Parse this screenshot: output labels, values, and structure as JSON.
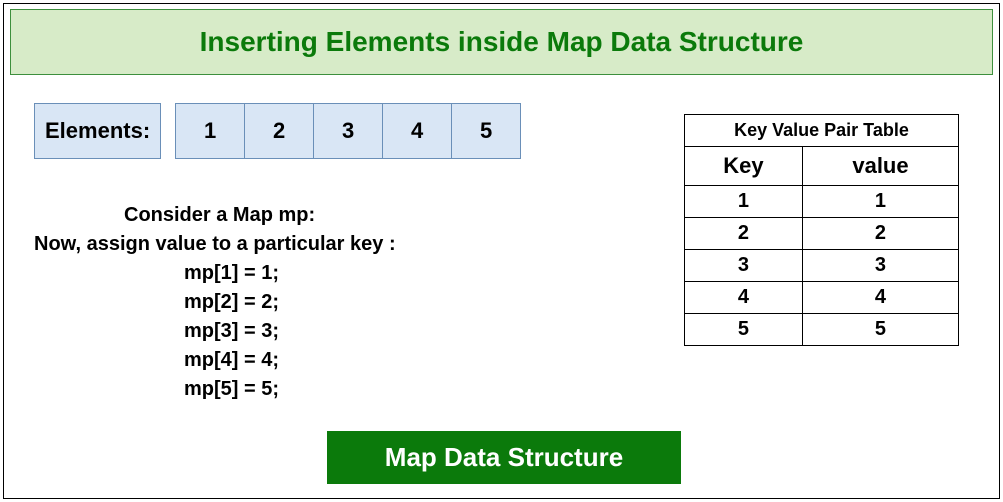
{
  "title": "Inserting Elements inside Map Data Structure",
  "elements_label": "Elements:",
  "elements": [
    "1",
    "2",
    "3",
    "4",
    "5"
  ],
  "code": {
    "l1": "Consider a Map mp:",
    "l2": "Now, assign value to a particular key :",
    "a1": "mp[1] = 1;",
    "a2": "mp[2] = 2;",
    "a3": "mp[3] =  3;",
    "a4": "mp[4] = 4;",
    "a5": "mp[5] = 5;"
  },
  "kv_table": {
    "caption": "Key Value Pair Table",
    "key_header": "Key",
    "value_header": "value",
    "rows": [
      {
        "k": "1",
        "v": "1"
      },
      {
        "k": "2",
        "v": "2"
      },
      {
        "k": "3",
        "v": "3"
      },
      {
        "k": "4",
        "v": "4"
      },
      {
        "k": "5",
        "v": "5"
      }
    ]
  },
  "footer_label": "Map Data Structure"
}
